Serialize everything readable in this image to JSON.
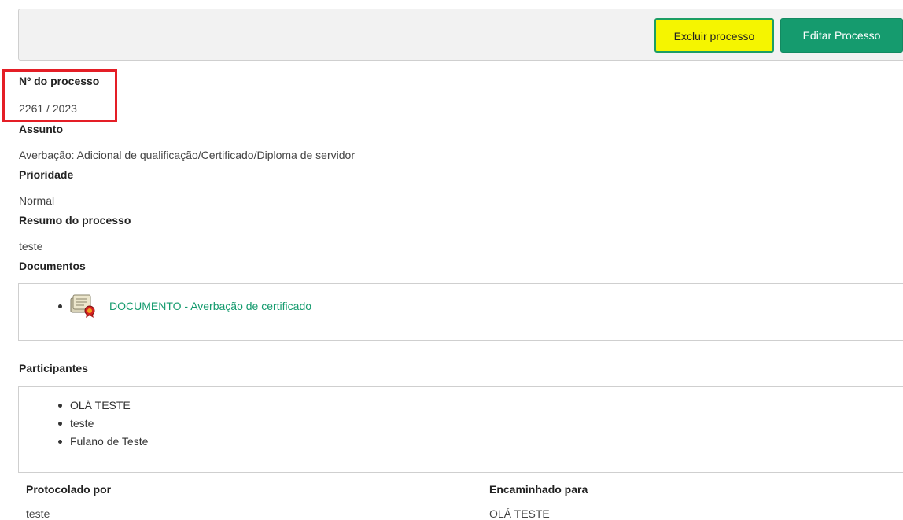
{
  "toolbar": {
    "delete_label": "Excluir processo",
    "edit_label": "Editar Processo"
  },
  "process": {
    "number_label": "Nº do processo",
    "number_value": "2261 / 2023",
    "subject_label": "Assunto",
    "subject_value": "Averbação: Adicional de qualificação/Certificado/Diploma de servidor",
    "priority_label": "Prioridade",
    "priority_value": "Normal",
    "summary_label": "Resumo do processo",
    "summary_value": "teste"
  },
  "documents": {
    "label": "Documentos",
    "items": [
      {
        "label": "DOCUMENTO - Averbação de certificado",
        "icon": "certificate-document-icon"
      }
    ]
  },
  "participants": {
    "label": "Participantes",
    "items": [
      "OLÁ TESTE",
      "teste",
      "Fulano de Teste"
    ]
  },
  "footer": {
    "protocolado_label": "Protocolado por",
    "protocolado_value": "teste",
    "encaminhado_label": "Encaminhado para",
    "encaminhado_value": "OLÁ TESTE"
  },
  "colors": {
    "accent_green": "#159b6e",
    "delete_bg": "#f5f500",
    "highlight_red": "#e41e26"
  }
}
